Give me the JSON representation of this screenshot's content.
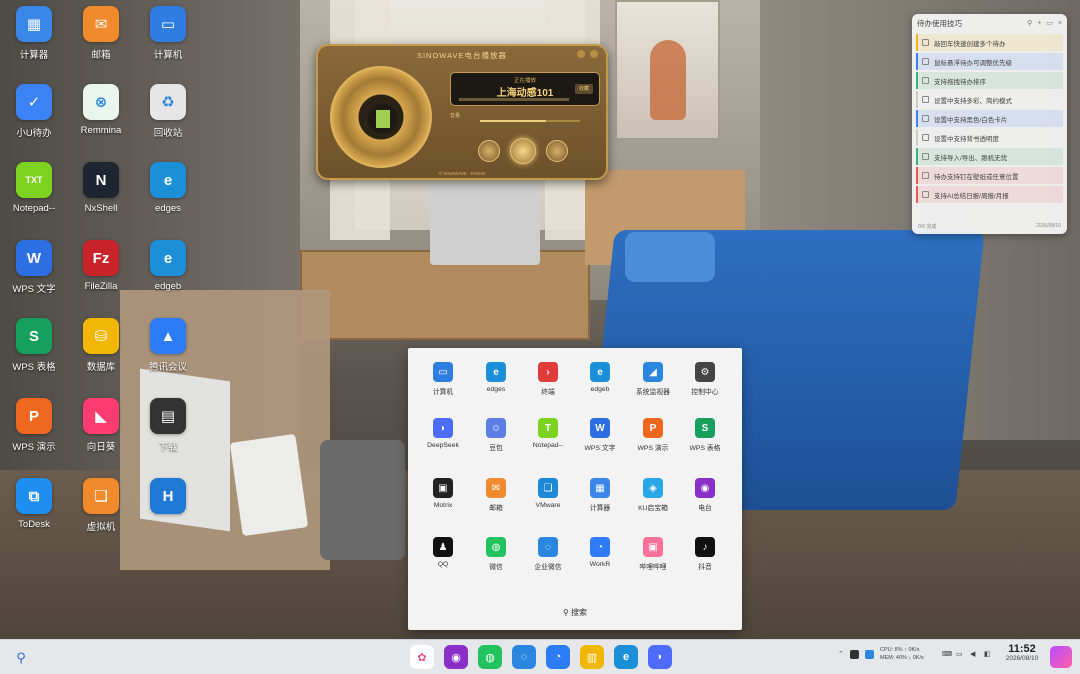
{
  "desktop_icons": [
    {
      "label": "计算器",
      "icon": "calculator-icon",
      "color": "#3a86e6",
      "glyph": "▦"
    },
    {
      "label": "邮箱",
      "icon": "mail-icon",
      "color": "#f08a2c",
      "glyph": "✉"
    },
    {
      "label": "计算机",
      "icon": "computer-icon",
      "color": "#2f7de1",
      "glyph": "▭"
    },
    {
      "label": "小U待办",
      "icon": "todo-icon",
      "color": "#3b82f6",
      "glyph": "✓"
    },
    {
      "label": "Remmina",
      "icon": "remmina-icon",
      "color": "#eaf5ee",
      "glyph": "⊗"
    },
    {
      "label": "回收站",
      "icon": "recycle-bin-icon",
      "color": "#e6e6e6",
      "glyph": "♻"
    },
    {
      "label": "Notepad--",
      "icon": "notepad-icon",
      "color": "#7ed321",
      "glyph": "TXT"
    },
    {
      "label": "NxShell",
      "icon": "terminal-icon",
      "color": "#1d2530",
      "glyph": "N"
    },
    {
      "label": "edges",
      "icon": "edge-icon",
      "color": "#1b8fd8",
      "glyph": "e"
    },
    {
      "label": "WPS 文字",
      "icon": "wps-writer-icon",
      "color": "#2b6fe3",
      "glyph": "W"
    },
    {
      "label": "FileZilla",
      "icon": "filezilla-icon",
      "color": "#c9232a",
      "glyph": "Fz"
    },
    {
      "label": "edgeb",
      "icon": "edge-beta-icon",
      "color": "#1b8fd8",
      "glyph": "e"
    },
    {
      "label": "WPS 表格",
      "icon": "wps-sheet-icon",
      "color": "#17a05d",
      "glyph": "S"
    },
    {
      "label": "数据库",
      "icon": "database-icon",
      "color": "#f2b705",
      "glyph": "⛁"
    },
    {
      "label": "腾讯会议",
      "icon": "tencent-meeting-icon",
      "color": "#2b7cf6",
      "glyph": "▲"
    },
    {
      "label": "WPS 演示",
      "icon": "wps-slides-icon",
      "color": "#f0671f",
      "glyph": "P"
    },
    {
      "label": "向日葵",
      "icon": "sunlogin-icon",
      "color": "#ff3d6e",
      "glyph": "◣"
    },
    {
      "label": "下载",
      "icon": "download-icon",
      "color": "#333333",
      "glyph": "▤"
    },
    {
      "label": "ToDesk",
      "icon": "todesk-icon",
      "color": "#1f8ef1",
      "glyph": "⧉"
    },
    {
      "label": "虚拟机",
      "icon": "vm-icon",
      "color": "#f08a2c",
      "glyph": "❏"
    },
    {
      "label": "",
      "icon": "browser-h-icon",
      "color": "#1f7ad6",
      "glyph": "H"
    }
  ],
  "radio": {
    "title": "SINOWAVE电台播放器",
    "station_sub": "正在播放",
    "station": "上海动感101",
    "fav": "收藏",
    "volume_label": "音量",
    "volume_level": 0.66,
    "footer": "© SINOWAVE · RADIO"
  },
  "todo": {
    "title": "待办使用技巧",
    "items": [
      {
        "text": "敲回车快速创建多个待办",
        "color": "#f2b705"
      },
      {
        "text": "鼠标悬浮待办可调整优先级",
        "color": "#3b82f6"
      },
      {
        "text": "支持拖拽待办排序",
        "color": "#3cb371"
      },
      {
        "text": "设置中支持多彩、简约模式",
        "color": "#cccccc"
      },
      {
        "text": "设置中支持黑色/白色卡片",
        "color": "#3b82f6"
      },
      {
        "text": "设置中支持背书透明度",
        "color": "#cccccc"
      },
      {
        "text": "支持导入/导出、跟机无忧",
        "color": "#3cb371"
      },
      {
        "text": "待办支持钉在壁纸或任意位置",
        "color": "#e85a5a"
      },
      {
        "text": "支持AI总结日报/周报/月报",
        "color": "#e85a5a"
      }
    ],
    "footer_left": "0/9 完成",
    "footer_right": "2026/08/10"
  },
  "start_menu": {
    "apps": [
      {
        "label": "计算机",
        "icon": "computer-icon",
        "color": "#2f7de1",
        "glyph": "▭"
      },
      {
        "label": "edges",
        "icon": "edge-icon",
        "color": "#1b8fd8",
        "glyph": "e"
      },
      {
        "label": "终端",
        "icon": "terminal-icon",
        "color": "#e23b3b",
        "glyph": "›"
      },
      {
        "label": "edgeb",
        "icon": "edge-beta-icon",
        "color": "#1b8fd8",
        "glyph": "e"
      },
      {
        "label": "系统监视器",
        "icon": "system-monitor-icon",
        "color": "#2b86e0",
        "glyph": "◢"
      },
      {
        "label": "控制中心",
        "icon": "control-center-icon",
        "color": "#444444",
        "glyph": "⚙"
      },
      {
        "label": "DeepSeek",
        "icon": "deepseek-icon",
        "color": "#4d6bfe",
        "glyph": "◗"
      },
      {
        "label": "豆包",
        "icon": "doubao-icon",
        "color": "#5a7de6",
        "glyph": "☺"
      },
      {
        "label": "Notepad--",
        "icon": "notepad-icon",
        "color": "#7ed321",
        "glyph": "T"
      },
      {
        "label": "WPS 文字",
        "icon": "wps-writer-icon",
        "color": "#2b6fe3",
        "glyph": "W"
      },
      {
        "label": "WPS 演示",
        "icon": "wps-slides-icon",
        "color": "#f0671f",
        "glyph": "P"
      },
      {
        "label": "WPS 表格",
        "icon": "wps-sheet-icon",
        "color": "#17a05d",
        "glyph": "S"
      },
      {
        "label": "Motrix",
        "icon": "motrix-icon",
        "color": "#222222",
        "glyph": "▣"
      },
      {
        "label": "邮箱",
        "icon": "mail-icon",
        "color": "#f08a2c",
        "glyph": "✉"
      },
      {
        "label": "VMware",
        "icon": "vmware-icon",
        "color": "#1e88d8",
        "glyph": "❏"
      },
      {
        "label": "计算器",
        "icon": "calculator-icon",
        "color": "#3a86e6",
        "glyph": "▦"
      },
      {
        "label": "KU启宝箱",
        "icon": "ku-toolbox-icon",
        "color": "#2aa7e8",
        "glyph": "◈"
      },
      {
        "label": "电台",
        "icon": "radio-icon",
        "color": "#8b2fc9",
        "glyph": "◉"
      },
      {
        "label": "QQ",
        "icon": "qq-icon",
        "color": "#111111",
        "glyph": "♟"
      },
      {
        "label": "微信",
        "icon": "wechat-icon",
        "color": "#22c35e",
        "glyph": "◍"
      },
      {
        "label": "企业微信",
        "icon": "wecom-icon",
        "color": "#2b86e0",
        "glyph": "◌"
      },
      {
        "label": "WorkR",
        "icon": "workr-icon",
        "color": "#2b7cf6",
        "glyph": "◔"
      },
      {
        "label": "哔哩哔哩",
        "icon": "bilibili-icon",
        "color": "#fb7299",
        "glyph": "▣"
      },
      {
        "label": "抖音",
        "icon": "douyin-icon",
        "color": "#111111",
        "glyph": "♪"
      }
    ],
    "search_label": "搜索"
  },
  "taskbar": {
    "apps": [
      {
        "icon": "launcher-icon",
        "color": "#ffffff",
        "glyph": "✿"
      },
      {
        "icon": "podcast-icon",
        "color": "#8b2fc9",
        "glyph": "◉"
      },
      {
        "icon": "wechat-icon",
        "color": "#22c35e",
        "glyph": "◍"
      },
      {
        "icon": "wecom-icon",
        "color": "#2b86e0",
        "glyph": "◌"
      },
      {
        "icon": "workr-icon",
        "color": "#2b7cf6",
        "glyph": "◔"
      },
      {
        "icon": "store-icon",
        "color": "#f2b705",
        "glyph": "▥"
      },
      {
        "icon": "edge-icon",
        "color": "#1b8fd8",
        "glyph": "e"
      },
      {
        "icon": "deepseek-icon",
        "color": "#4d6bfe",
        "glyph": "◗"
      }
    ],
    "cpu_label": "CPU:",
    "cpu_value": "8%",
    "mem_label": "MEM:",
    "mem_value": "40%",
    "net_up": "0K/s",
    "net_down": "0K/s",
    "time": "11:52",
    "date": "2026/08/10"
  }
}
